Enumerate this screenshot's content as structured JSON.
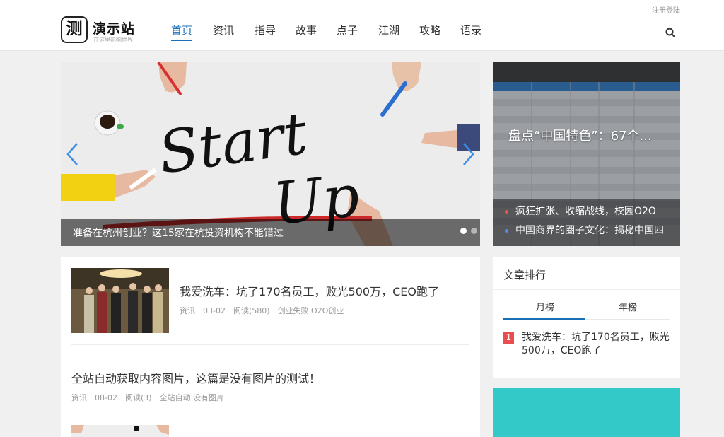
{
  "header": {
    "top_link": "注册登陆",
    "logo_mark": "测",
    "logo_title": "演示站",
    "logo_sub": "在这里影响世界",
    "nav": [
      "首页",
      "资讯",
      "指导",
      "故事",
      "点子",
      "江湖",
      "攻略",
      "语录"
    ],
    "active_index": 0,
    "search_icon": "search-icon"
  },
  "slider": {
    "caption": "准备在杭州创业？这15家在杭投资机构不能错过",
    "image_text": "Start Up",
    "dots": 2,
    "active_dot": 0
  },
  "side_slider": {
    "title": "盘点“中国特色”：67个...",
    "items": [
      {
        "text": "疯狂扩张、收缩战线，校园O2O",
        "bullet_color": "#e8594a"
      },
      {
        "text": "中国商界的圈子文化：揭秘中国四",
        "bullet_color": "#5b8fe6"
      }
    ]
  },
  "articles": [
    {
      "title": "我爱洗车：坑了170名员工，败光500万，CEO跑了",
      "category": "资讯",
      "date": "03-02",
      "reads": "阅读(580)",
      "tags": "创业失败 O2O创业",
      "has_thumb": true
    },
    {
      "title": "全站自动获取内容图片，这篇是没有图片的测试！",
      "category": "资讯",
      "date": "08-02",
      "reads": "阅读(3)",
      "tags": "全站自动 没有图片",
      "has_thumb": false
    }
  ],
  "ranking": {
    "title": "文章排行",
    "tabs": [
      "月榜",
      "年榜"
    ],
    "active_tab": 0,
    "items": [
      {
        "num": "1",
        "title": "我爱洗车：坑了170名员工，败光500万，CEO跑了"
      }
    ]
  },
  "colors": {
    "accent": "#1b6fb5",
    "rank_badge": "#e84e4e",
    "teal": "#33c9c9"
  }
}
